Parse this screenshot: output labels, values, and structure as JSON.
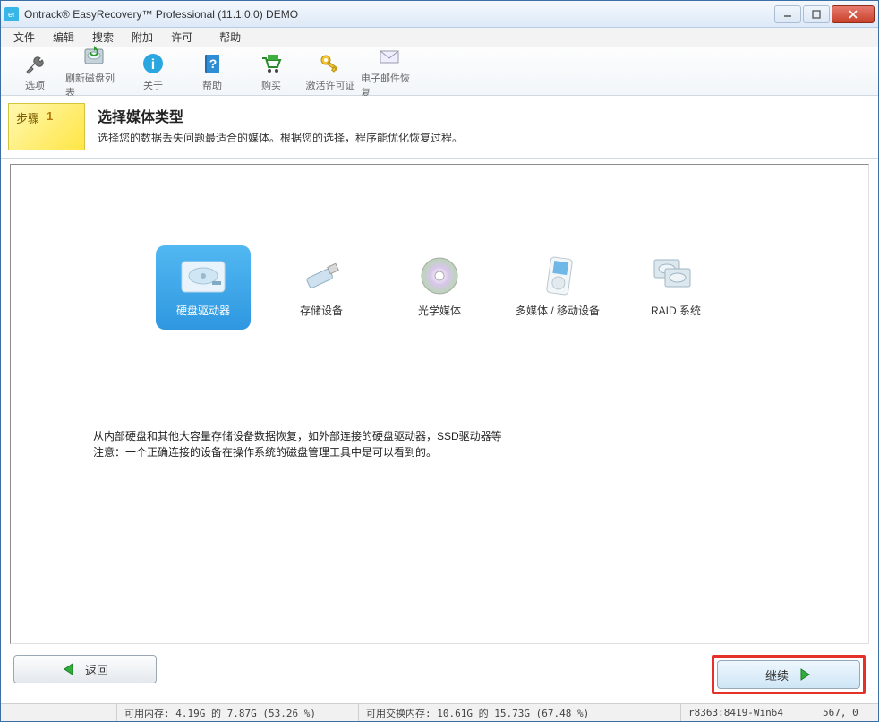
{
  "window": {
    "title": "Ontrack® EasyRecovery™ Professional (11.1.0.0) DEMO"
  },
  "menu": {
    "file": "文件",
    "edit": "编辑",
    "search": "搜索",
    "addon": "附加",
    "license": "许可",
    "help": "帮助"
  },
  "toolbar": {
    "options": "选项",
    "refresh": "刷新磁盘列表",
    "about": "关于",
    "help": "帮助",
    "buy": "购买",
    "activate": "激活许可证",
    "email": "电子邮件恢复"
  },
  "step": {
    "label": "步骤",
    "number": "1",
    "title": "选择媒体类型",
    "desc": "选择您的数据丢失问题最适合的媒体。根据您的选择，程序能优化恢复过程。"
  },
  "media": {
    "hdd": "硬盘驱动器",
    "storage": "存储设备",
    "optical": "光学媒体",
    "multimedia": "多媒体 / 移动设备",
    "raid": "RAID 系统"
  },
  "hint": {
    "line1": "从内部硬盘和其他大容量存储设备数据恢复，如外部连接的硬盘驱动器，SSD驱动器等",
    "line2": "注意：一个正确连接的设备在操作系统的磁盘管理工具中是可以看到的。"
  },
  "nav": {
    "back": "返回",
    "continue": "继续"
  },
  "status": {
    "mem": "可用内存: 4.19G 的 7.87G (53.26 %)",
    "swap": "可用交换内存: 10.61G 的 15.73G (67.48 %)",
    "build": "r8363:8419-Win64",
    "pos": "567, 0"
  }
}
